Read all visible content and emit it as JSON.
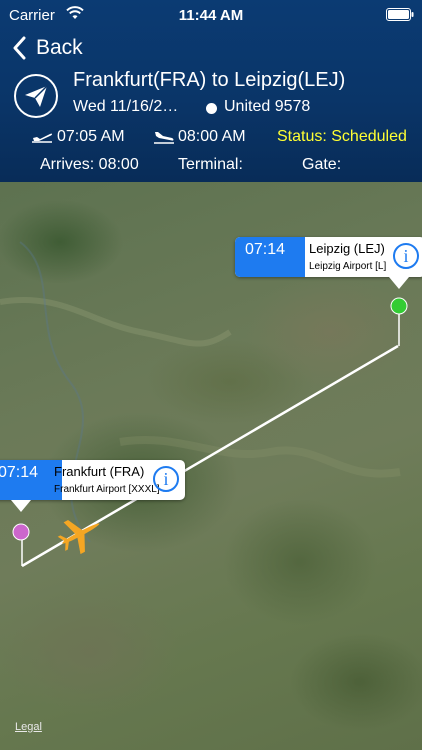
{
  "status_bar": {
    "carrier": "Carrier",
    "time": "11:44 AM"
  },
  "nav": {
    "back_label": "Back"
  },
  "flight": {
    "route_title": "Frankfurt(FRA) to Leipzig(LEJ)",
    "date": "Wed 11/16/2…",
    "flight_number": "United 9578",
    "departure_time": "07:05 AM",
    "arrival_time": "08:00 AM",
    "status": "Status: Scheduled",
    "arrives": "Arrives: 08:00",
    "terminal": "Terminal:",
    "gate": "Gate:"
  },
  "map": {
    "destination_callout": {
      "time": "07:14",
      "name": "Leipzig (LEJ)",
      "airport": "Leipzig Airport [L]",
      "info": "i"
    },
    "origin_callout": {
      "time": "07:14",
      "name": "Frankfurt (FRA)",
      "airport": "Frankfurt Airport [XXXL]",
      "info": "i"
    },
    "legal": "Legal"
  },
  "colors": {
    "header_bg": "#0a3568",
    "status_yellow": "#ffff33",
    "callout_blue": "#1e7bf0",
    "origin_pin": "#cc66cc",
    "destination_pin": "#33cc33",
    "plane": "#f5a623"
  }
}
